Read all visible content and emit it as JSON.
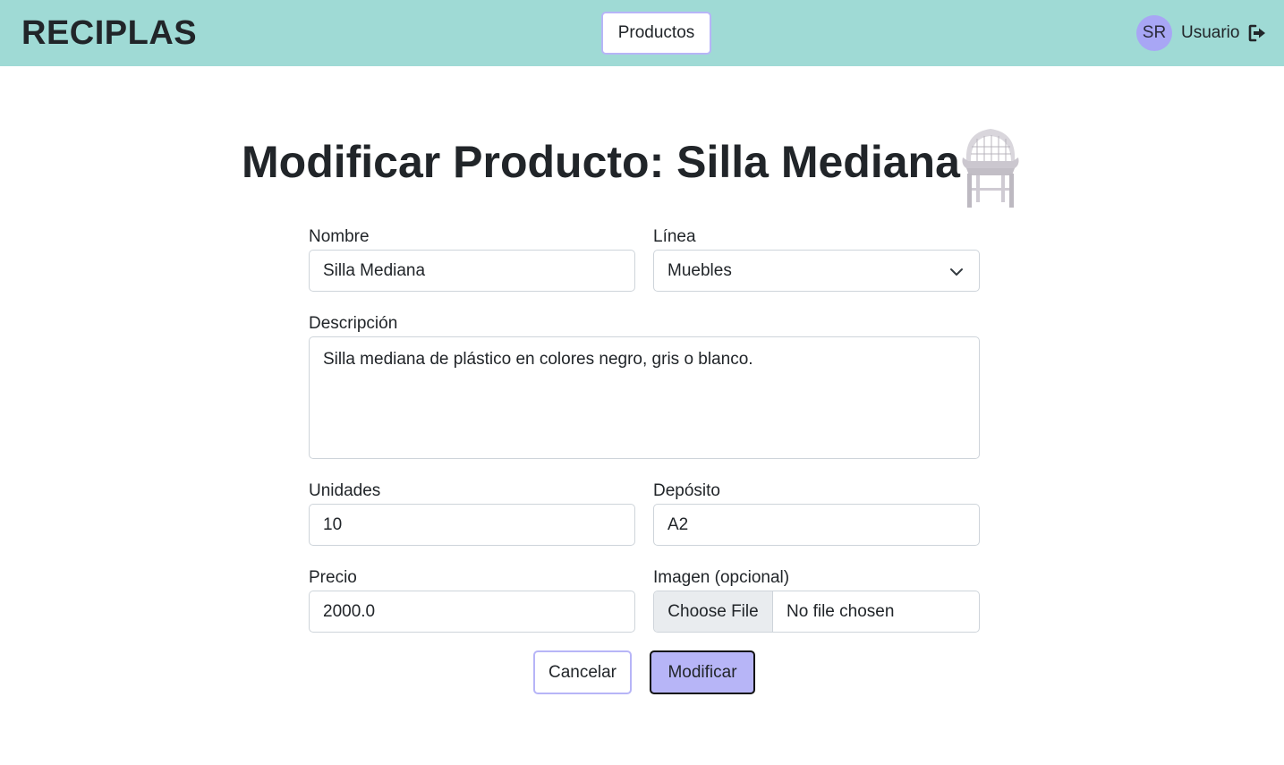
{
  "app": {
    "brand": "RECIPLAS"
  },
  "nav": {
    "products_label": "Productos"
  },
  "user": {
    "initials": "SR",
    "name": "Usuario",
    "logout_icon": "logout-icon"
  },
  "page": {
    "title": "Modificar Producto: Silla Mediana",
    "image_icon": "plastic-chair-image"
  },
  "form": {
    "nombre": {
      "label": "Nombre",
      "value": "Silla Mediana"
    },
    "linea": {
      "label": "Línea",
      "value": "Muebles"
    },
    "descripcion": {
      "label": "Descripción",
      "value": "Silla mediana de plástico en colores negro, gris o blanco."
    },
    "unidades": {
      "label": "Unidades",
      "value": "10"
    },
    "deposito": {
      "label": "Depósito",
      "value": "A2"
    },
    "precio": {
      "label": "Precio",
      "value": "2000.0"
    },
    "imagen": {
      "label": "Imagen (opcional)",
      "button": "Choose File",
      "status": "No file chosen"
    }
  },
  "actions": {
    "cancel_label": "Cancelar",
    "submit_label": "Modificar"
  },
  "colors": {
    "navbar": "#9fdad5",
    "accent": "#b7b5f7",
    "avatar": "#a8a6f5"
  }
}
